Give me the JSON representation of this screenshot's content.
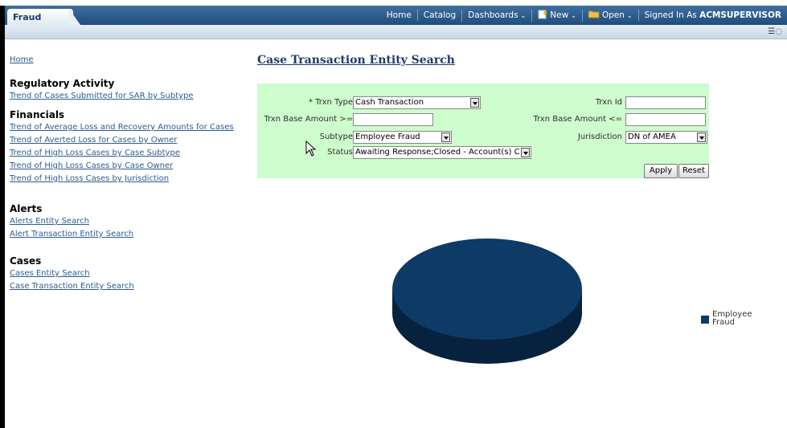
{
  "header": {
    "tab_label": "Fraud",
    "nav": {
      "home": "Home",
      "catalog": "Catalog",
      "dashboards": "Dashboards",
      "new": "New",
      "open": "Open",
      "signed_in_prefix": "Signed In As",
      "user": "ACMSUPERVISOR"
    }
  },
  "sidebar": {
    "home": "Home",
    "sections": [
      {
        "title": "Regulatory Activity",
        "links": [
          "Trend of Cases Submitted for SAR by Subtype"
        ]
      },
      {
        "title": "Financials",
        "links": [
          "Trend of Average Loss and Recovery Amounts for Cases",
          "Trend of Averted Loss for Cases by Owner",
          "Trend of High Loss Cases by Case Subtype",
          "Trend of High Loss Cases by Case Owner",
          "Trend of High Loss Cases by Jurisdiction"
        ]
      },
      {
        "title": "Alerts",
        "links": [
          "Alerts Entity Search",
          "Alert Transaction Entity Search"
        ]
      },
      {
        "title": "Cases",
        "links": [
          "Cases Entity Search",
          "Case Transaction Entity Search"
        ]
      }
    ]
  },
  "main": {
    "title": "Case Transaction Entity Search",
    "form": {
      "trxn_type_label": "* Trxn Type",
      "trxn_type_value": "Cash Transaction",
      "base_ge_label": "Trxn Base Amount >=",
      "subtype_label": "Subtype",
      "subtype_value": "Employee Fraud",
      "status_label": "Status",
      "status_value": "Awaiting Response;Closed - Account(s) C",
      "trxn_id_label": "Trxn Id",
      "base_le_label": "Trxn Base Amount <=",
      "jurisdiction_label": "Jurisdiction",
      "jurisdiction_value": "DN of AMEA",
      "apply": "Apply",
      "reset": "Reset"
    }
  },
  "chart_data": {
    "type": "pie",
    "series": [
      {
        "name": "Employee Fraud",
        "values": [
          100
        ]
      }
    ],
    "categories": [
      "Employee Fraud"
    ],
    "legend": [
      "Employee",
      "Fraud"
    ],
    "legend_position": "right",
    "color": "#0e3a66"
  }
}
